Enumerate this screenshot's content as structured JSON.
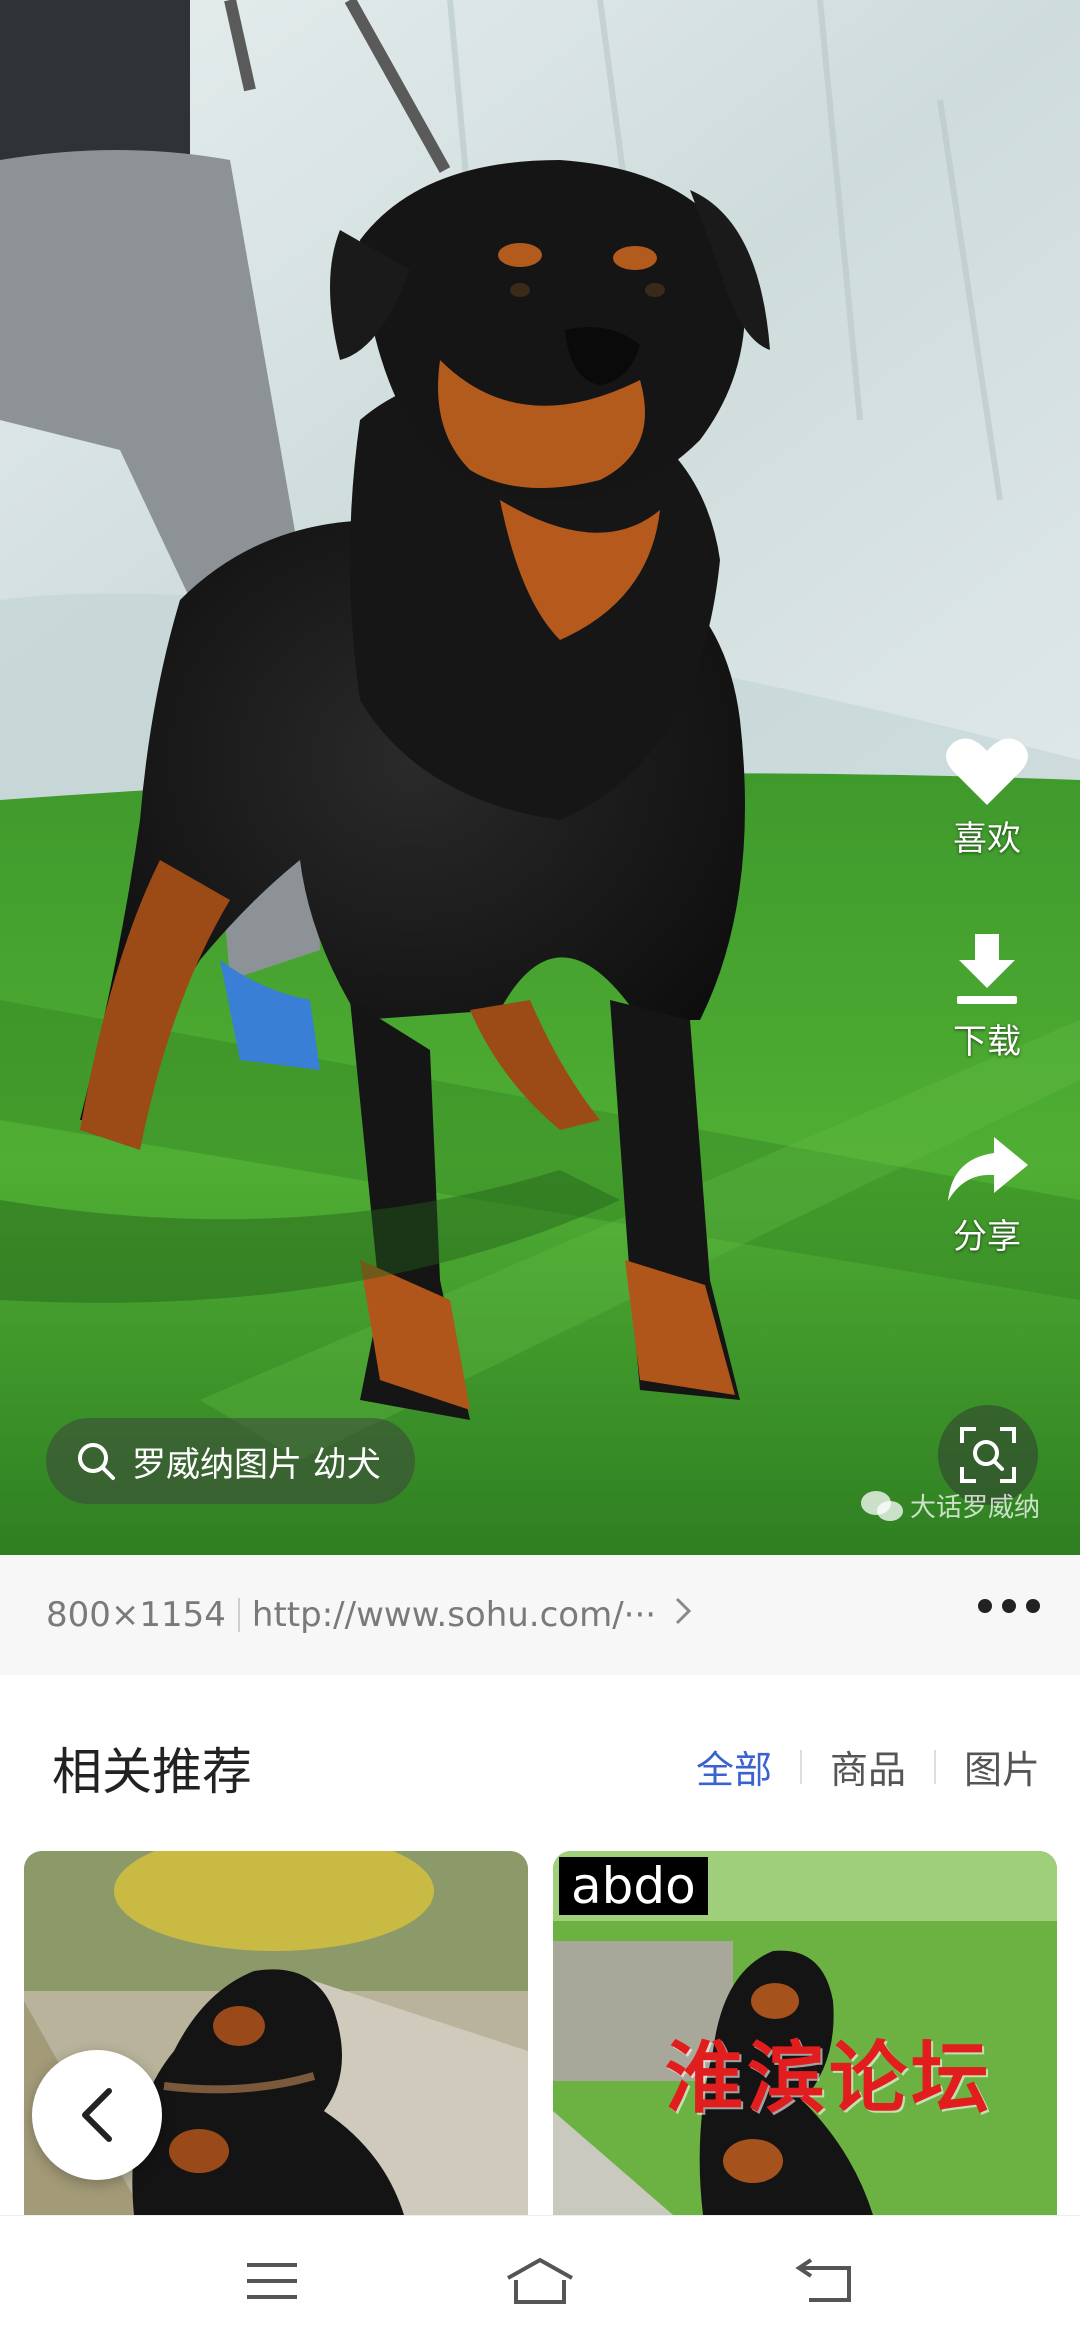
{
  "viewer": {
    "actions": {
      "like_label": "喜欢",
      "download_label": "下载",
      "share_label": "分享"
    },
    "search_chip": "罗威纳图片 幼犬",
    "watermark": "大话罗威纳",
    "icons": [
      "heart-icon",
      "download-icon",
      "share-icon",
      "search-icon",
      "lens-icon",
      "wechat-icon"
    ]
  },
  "image_info": {
    "dimensions": "800×1154",
    "source_url": "http://www.sohu.com/···",
    "more_icon": "more-dots-icon"
  },
  "related": {
    "title": "相关推荐",
    "tabs": [
      {
        "label": "全部",
        "active": true
      },
      {
        "label": "商品",
        "active": false
      },
      {
        "label": "图片",
        "active": false
      }
    ],
    "cards": [
      {
        "overlay_text": ""
      },
      {
        "tag": "abdo",
        "overlay_text": "淮滨论坛"
      }
    ],
    "accent_color": "#3a63d0"
  },
  "system_nav": {
    "icons": [
      "menu-icon",
      "home-icon",
      "back-icon"
    ]
  }
}
